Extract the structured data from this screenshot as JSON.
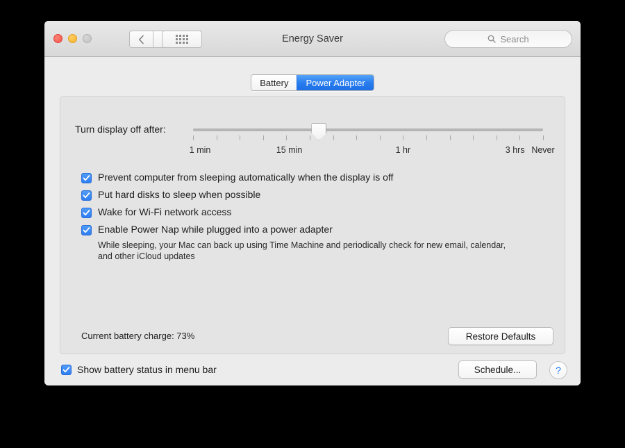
{
  "window": {
    "title": "Energy Saver",
    "traffic_lights": [
      "close-button",
      "minimize-button",
      "zoom-button"
    ],
    "nav": {
      "back": "back-icon",
      "forward": "forward-icon",
      "show_all": "grid-icon"
    },
    "search": {
      "placeholder": "Search",
      "icon": "search-icon"
    }
  },
  "tabs": [
    {
      "label": "Battery",
      "active": false
    },
    {
      "label": "Power Adapter",
      "active": true
    }
  ],
  "slider": {
    "label": "Turn display off after:",
    "value_label": "15 min",
    "value_position_pct": 36,
    "tick_count": 16,
    "scale": [
      {
        "label": "1 min",
        "pos_pct": 2
      },
      {
        "label": "15 min",
        "pos_pct": 27.5
      },
      {
        "label": "1 hr",
        "pos_pct": 60
      },
      {
        "label": "3 hrs",
        "pos_pct": 92
      },
      {
        "label": "Never",
        "pos_pct": 100
      }
    ]
  },
  "options": [
    {
      "label": "Prevent computer from sleeping automatically when the display is off",
      "checked": true
    },
    {
      "label": "Put hard disks to sleep when possible",
      "checked": true
    },
    {
      "label": "Wake for Wi-Fi network access",
      "checked": true
    },
    {
      "label": "Enable Power Nap while plugged into a power adapter",
      "checked": true
    }
  ],
  "power_nap_description": "While sleeping, your Mac can back up using Time Machine and periodically check for new email, calendar, and other iCloud updates",
  "battery_status": "Current battery charge: 73%",
  "restore_defaults_label": "Restore Defaults",
  "menu_bar_option": {
    "label": "Show battery status in menu bar",
    "checked": true
  },
  "schedule_label": "Schedule...",
  "help_label": "?",
  "colors": {
    "accent_blue": "#2f7df3",
    "tab_active_blue": "#2a7eef",
    "help_blue": "#1977f3",
    "window_bg": "#ececec",
    "panel_bg": "#e4e4e4"
  }
}
